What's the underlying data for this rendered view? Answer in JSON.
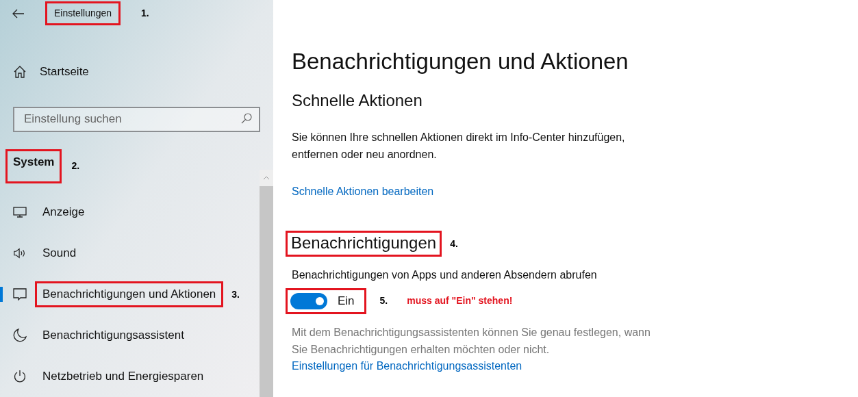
{
  "header": {
    "title": "Einstellungen",
    "highlighted": true,
    "marker": "1."
  },
  "home": {
    "label": "Startseite"
  },
  "search": {
    "placeholder": "Einstellung suchen"
  },
  "section": {
    "label": "System",
    "highlighted": true,
    "marker": "2."
  },
  "sidebar": {
    "items": [
      {
        "label": "Anzeige",
        "kind": "display",
        "selected": false,
        "highlighted": false
      },
      {
        "label": "Sound",
        "kind": "sound",
        "selected": false,
        "highlighted": false
      },
      {
        "label": "Benachrichtigungen und Aktionen",
        "kind": "message",
        "selected": true,
        "highlighted": true,
        "marker": "3."
      },
      {
        "label": "Benachrichtigungsassistent",
        "kind": "moon",
        "selected": false,
        "highlighted": false
      },
      {
        "label": "Netzbetrieb und Energiesparen",
        "kind": "power",
        "selected": false,
        "highlighted": false
      }
    ]
  },
  "page": {
    "title": "Benachrichtigungen und Aktionen",
    "quick_actions": {
      "heading": "Schnelle Aktionen",
      "text": "Sie können Ihre schnellen Aktionen direkt im Info-Center hinzufügen, entfernen oder neu anordnen.",
      "link": "Schnelle Aktionen bearbeiten"
    },
    "notifications": {
      "heading": "Benachrichtigungen",
      "highlighted": true,
      "marker": "4.",
      "toggle": {
        "label": "Benachrichtigungen von Apps und anderen Absendern abrufen",
        "on": true,
        "state_text": "Ein",
        "highlighted": true,
        "marker": "5.",
        "note": "muss auf \"Ein\" stehen!"
      },
      "text": "Mit dem Benachrichtigungsassistenten können Sie genau festlegen, wann Sie Benachrichtigungen erhalten möchten oder nicht.",
      "link": "Einstellungen für Benachrichtigungsassistenten"
    }
  }
}
